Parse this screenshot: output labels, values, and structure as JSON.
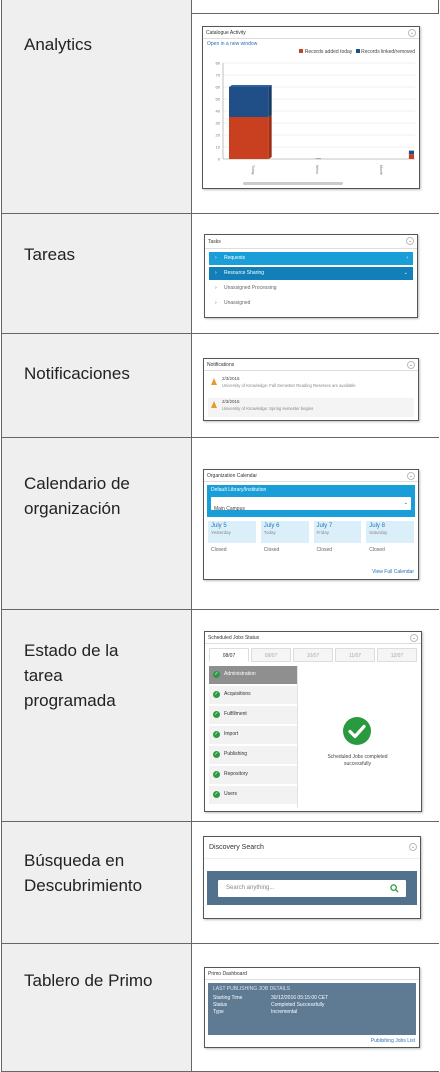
{
  "rows": [
    {
      "label": "Analytics"
    },
    {
      "label": "Tareas"
    },
    {
      "label": "Notificaciones"
    },
    {
      "label": "Calendario de organización"
    },
    {
      "label": "Estado de la tarea programada"
    },
    {
      "label": "Búsqueda en Descubrimiento"
    },
    {
      "label": "Tablero de Primo"
    }
  ],
  "analytics": {
    "title": "Catalogue Activity",
    "link": "Open in a new window",
    "legend": [
      "Records added today",
      "Records linked/removed"
    ],
    "colors": {
      "series1": "#c8401f",
      "series2": "#1f4f86"
    },
    "chart_data": {
      "type": "bar",
      "categories": [
        "Today",
        "Week",
        "Month"
      ],
      "series": [
        {
          "name": "Records added today",
          "values": [
            35,
            0.3,
            4
          ]
        },
        {
          "name": "Records linked/removed",
          "values": [
            25,
            0.1,
            3
          ]
        }
      ],
      "ylim": [
        0,
        80
      ]
    }
  },
  "tasks": {
    "title": "Tasks",
    "items": [
      {
        "label": "Requests",
        "style": "blue"
      },
      {
        "label": "Resource Sharing",
        "style": "dark"
      },
      {
        "label": "Unassigned Processing",
        "style": "plain"
      },
      {
        "label": "Unassigned",
        "style": "plain"
      }
    ]
  },
  "notifications": {
    "title": "Notifications",
    "items": [
      {
        "date": "2/3/2015",
        "text": "University of Knowledge: Fall Semester Reading Reserves are available"
      },
      {
        "date": "2/3/2015",
        "text": "University of Knowledge: Spring semester begins"
      }
    ]
  },
  "calendar": {
    "title": "Organization Calendar",
    "select_label": "Default Library/Institution",
    "select_value": "Main Campus",
    "days": [
      {
        "date": "July 5",
        "sub": "Yesterday",
        "status": "Closed"
      },
      {
        "date": "July 6",
        "sub": "Today",
        "status": "Closed"
      },
      {
        "date": "July 7",
        "sub": "Friday",
        "status": "Closed"
      },
      {
        "date": "July 8",
        "sub": "Saturday",
        "status": "Closed"
      }
    ],
    "link": "View Full Calendar"
  },
  "scheduled": {
    "title": "Scheduled Jobs Status",
    "tabs": [
      "08/07",
      "09/07",
      "10/07",
      "11/07",
      "12/07"
    ],
    "jobs": [
      "Administration",
      "Acquisitions",
      "Fulfillment",
      "Import",
      "Publishing",
      "Repository",
      "Users"
    ],
    "message": "Scheduled Jobs completed successfully"
  },
  "discovery": {
    "title": "Discovery Search",
    "placeholder": "Search anything..."
  },
  "primo": {
    "title": "Primo Dashboard",
    "heading": "LAST PUBLISHING JOB DETAILS",
    "rows": [
      {
        "k": "Starting Time",
        "v": "30/12/2016 05:15:00 CET"
      },
      {
        "k": "Status",
        "v": "Completed Successfully"
      },
      {
        "k": "Type",
        "v": "Incremental"
      }
    ],
    "link": "Publishing Jobs List"
  }
}
